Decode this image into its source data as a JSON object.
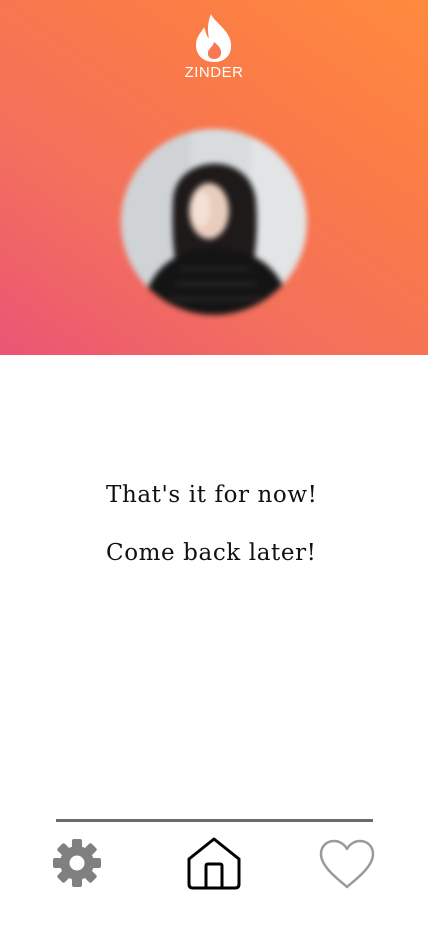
{
  "app": {
    "brand_name": "ZINDER",
    "accent_gradient": [
      "#e95574",
      "#ff8a3d"
    ]
  },
  "profile": {
    "photo_state": "blurred"
  },
  "empty_state": {
    "line1": "That's it for now!",
    "line2": "Come back later!"
  },
  "bottom_nav": {
    "items": [
      {
        "icon": "gear-icon",
        "color": "#808080"
      },
      {
        "icon": "home-icon",
        "color": "#000000"
      },
      {
        "icon": "heart-icon",
        "color": "#9a9a9a"
      }
    ]
  }
}
